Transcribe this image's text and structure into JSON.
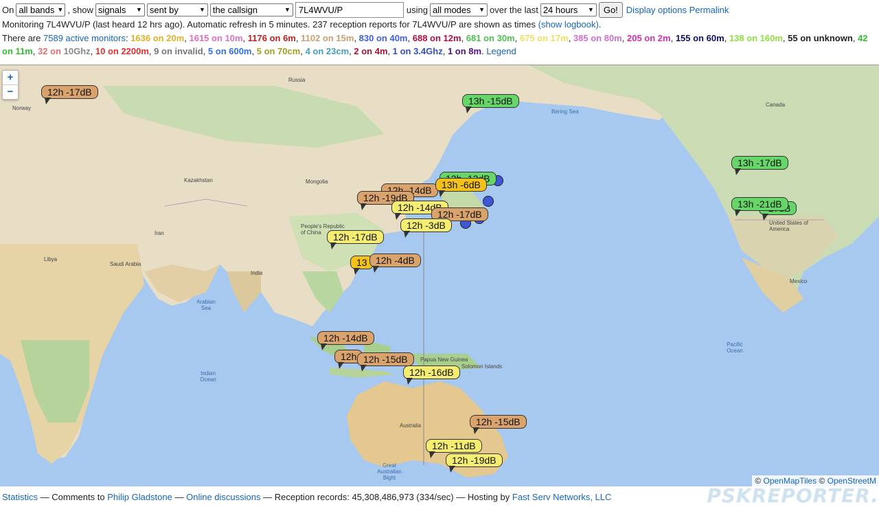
{
  "controls": {
    "on_label": "On",
    "band_select": "all bands",
    "show_label": ", show",
    "show_select": "signals",
    "direction_select": "sent by",
    "target_select": "the callsign",
    "callsign_value": "7L4WVU/P",
    "using_label": "using",
    "mode_select": "all modes",
    "over_label": "over the last",
    "period_select": "24 hours",
    "go_label": "Go!",
    "display_options_link": "Display options",
    "permalink_link": "Permalink"
  },
  "status": {
    "monitoring_text": "Monitoring 7L4WVU/P (last heard 12 hrs ago). Automatic refresh in 5 minutes. 237 reception reports for 7L4WVU/P are shown as times",
    "show_logbook_link": "(show logbook)",
    "period_end": "."
  },
  "monitors": {
    "prefix": "There are",
    "active_link": "7589 active monitors",
    "colon": ":",
    "bands": [
      {
        "text": "1636 on 20m",
        "color": "#e0b028"
      },
      {
        "text": "1615 on 10m",
        "color": "#e070c0"
      },
      {
        "text": "1176 on 6m",
        "color": "#c02020"
      },
      {
        "text": "1102 on 15m",
        "color": "#c8a070"
      },
      {
        "text": "830 on 40m",
        "color": "#4060e0"
      },
      {
        "text": "688 on 12m",
        "color": "#b01040"
      },
      {
        "text": "681 on 30m",
        "color": "#50c050"
      },
      {
        "text": "675 on 17m",
        "color": "#f0e060"
      },
      {
        "text": "385 on 80m",
        "color": "#d070d0"
      },
      {
        "text": "205 on 2m",
        "color": "#d030b0"
      },
      {
        "text": "155 on 60m",
        "color": "#101060"
      },
      {
        "text": "138 on 160m",
        "color": "#90e040"
      },
      {
        "text": "55 on unknown",
        "color": "#222222"
      },
      {
        "text": "42 on 11m",
        "color": "#30c030"
      },
      {
        "text": "32 on",
        "color": "#e07070"
      }
    ],
    "bands2": [
      {
        "text": "10Ghz",
        "color": "#888888"
      },
      {
        "text": "10 on 2200m",
        "color": "#e03030"
      },
      {
        "text": "9 on invalid",
        "color": "#777777"
      },
      {
        "text": "5 on 600m",
        "color": "#3070e0"
      },
      {
        "text": "5 on 70cm",
        "color": "#a0a020"
      },
      {
        "text": "4 on 23cm",
        "color": "#40a0c0"
      },
      {
        "text": "2 on 4m",
        "color": "#b01030"
      },
      {
        "text": "1 on 3.4Ghz",
        "color": "#3050c0"
      },
      {
        "text": "1 on 8m",
        "color": "#501080"
      }
    ],
    "legend_link": "Legend"
  },
  "map": {
    "zoom_in": "+",
    "zoom_out": "−",
    "labels": {
      "russia": "Russia",
      "mongolia": "Mongolia",
      "kazakhstan": "Kazakhstan",
      "china": "People's Republic of China",
      "india": "India",
      "australia": "Australia",
      "canada": "Canada",
      "usa": "United States of America",
      "mexico": "Mexico",
      "indian_ocean": "Indian Ocean",
      "pacific_ocean": "Pacific Ocean",
      "bering_sea": "Bering Sea",
      "arabian_sea": "Arabian Sea",
      "great_bight": "Great Australian Bight",
      "libya": "Libya",
      "saudi": "Saudi Arabia",
      "iran": "Iran",
      "norway": "Norway",
      "solomon": "Solomon Islands",
      "new_guinea": "Papua New Guinea"
    },
    "reports": [
      {
        "text": "12h -17dB",
        "color": "c-orange"
      },
      {
        "text": "13h -15dB",
        "color": "c-green"
      },
      {
        "text": "13h -17dB",
        "color": "c-green"
      },
      {
        "text": "13h -21dB",
        "color": "c-green"
      },
      {
        "text": "-17dB",
        "color": "c-green"
      },
      {
        "text": "12h -13dB",
        "color": "c-green"
      },
      {
        "text": "12h -14dB",
        "color": "c-orange"
      },
      {
        "text": "13h -6dB",
        "color": "c-gold"
      },
      {
        "text": "12h -19dB",
        "color": "c-orange"
      },
      {
        "text": "12h -14dB",
        "color": "c-yellow"
      },
      {
        "text": "12h -17dB",
        "color": "c-orange"
      },
      {
        "text": "12h -3dB",
        "color": "c-yellow"
      },
      {
        "text": "12h -17dB",
        "color": "c-yellow"
      },
      {
        "text": "12h -4dB",
        "color": "c-orange"
      },
      {
        "text": "13",
        "color": "c-gold"
      },
      {
        "text": "12h -14dB",
        "color": "c-orange"
      },
      {
        "text": "12h",
        "color": "c-orange"
      },
      {
        "text": "12h -15dB",
        "color": "c-orange"
      },
      {
        "text": "12h -16dB",
        "color": "c-yellow"
      },
      {
        "text": "12h -15dB",
        "color": "c-orange"
      },
      {
        "text": "12h -11dB",
        "color": "c-yellow"
      },
      {
        "text": "12h -19dB",
        "color": "c-yellow"
      }
    ],
    "attribution_prefix": "©",
    "attribution_link1": "OpenMapTiles",
    "attribution_mid": "©",
    "attribution_link2": "OpenStreetM"
  },
  "footer": {
    "statistics_link": "Statistics",
    "sep1": "— Comments to",
    "author_link": "Philip Gladstone",
    "sep2": "—",
    "discussions_link": "Online discussions",
    "records_text": "— Reception records: 45,308,486,973 (334/sec) — Hosting by",
    "hosting_link": "Fast Serv Networks, LLC",
    "logo": "PSKREPORTER."
  }
}
